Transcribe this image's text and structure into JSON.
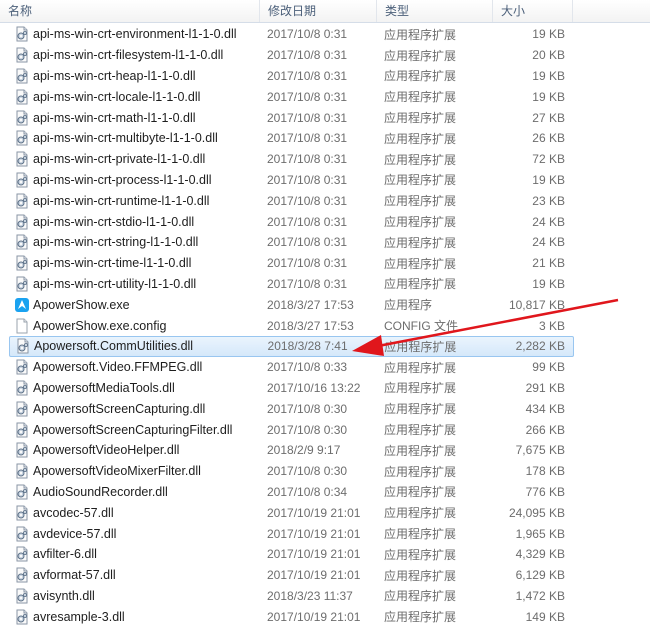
{
  "columns": {
    "name": "名称",
    "date": "修改日期",
    "type": "类型",
    "size": "大小"
  },
  "files": [
    {
      "name": "api-ms-win-crt-environment-l1-1-0.dll",
      "date": "2017/10/8 0:31",
      "type": "应用程序扩展",
      "size": "19 KB",
      "icon": "dll-file-icon"
    },
    {
      "name": "api-ms-win-crt-filesystem-l1-1-0.dll",
      "date": "2017/10/8 0:31",
      "type": "应用程序扩展",
      "size": "20 KB",
      "icon": "dll-file-icon"
    },
    {
      "name": "api-ms-win-crt-heap-l1-1-0.dll",
      "date": "2017/10/8 0:31",
      "type": "应用程序扩展",
      "size": "19 KB",
      "icon": "dll-file-icon"
    },
    {
      "name": "api-ms-win-crt-locale-l1-1-0.dll",
      "date": "2017/10/8 0:31",
      "type": "应用程序扩展",
      "size": "19 KB",
      "icon": "dll-file-icon"
    },
    {
      "name": "api-ms-win-crt-math-l1-1-0.dll",
      "date": "2017/10/8 0:31",
      "type": "应用程序扩展",
      "size": "27 KB",
      "icon": "dll-file-icon"
    },
    {
      "name": "api-ms-win-crt-multibyte-l1-1-0.dll",
      "date": "2017/10/8 0:31",
      "type": "应用程序扩展",
      "size": "26 KB",
      "icon": "dll-file-icon"
    },
    {
      "name": "api-ms-win-crt-private-l1-1-0.dll",
      "date": "2017/10/8 0:31",
      "type": "应用程序扩展",
      "size": "72 KB",
      "icon": "dll-file-icon"
    },
    {
      "name": "api-ms-win-crt-process-l1-1-0.dll",
      "date": "2017/10/8 0:31",
      "type": "应用程序扩展",
      "size": "19 KB",
      "icon": "dll-file-icon"
    },
    {
      "name": "api-ms-win-crt-runtime-l1-1-0.dll",
      "date": "2017/10/8 0:31",
      "type": "应用程序扩展",
      "size": "23 KB",
      "icon": "dll-file-icon"
    },
    {
      "name": "api-ms-win-crt-stdio-l1-1-0.dll",
      "date": "2017/10/8 0:31",
      "type": "应用程序扩展",
      "size": "24 KB",
      "icon": "dll-file-icon"
    },
    {
      "name": "api-ms-win-crt-string-l1-1-0.dll",
      "date": "2017/10/8 0:31",
      "type": "应用程序扩展",
      "size": "24 KB",
      "icon": "dll-file-icon"
    },
    {
      "name": "api-ms-win-crt-time-l1-1-0.dll",
      "date": "2017/10/8 0:31",
      "type": "应用程序扩展",
      "size": "21 KB",
      "icon": "dll-file-icon"
    },
    {
      "name": "api-ms-win-crt-utility-l1-1-0.dll",
      "date": "2017/10/8 0:31",
      "type": "应用程序扩展",
      "size": "19 KB",
      "icon": "dll-file-icon"
    },
    {
      "name": "ApowerShow.exe",
      "date": "2018/3/27 17:53",
      "type": "应用程序",
      "size": "10,817 KB",
      "icon": "apowershow-app-icon"
    },
    {
      "name": "ApowerShow.exe.config",
      "date": "2018/3/27 17:53",
      "type": "CONFIG 文件",
      "size": "3 KB",
      "icon": "config-file-icon"
    },
    {
      "name": "Apowersoft.CommUtilities.dll",
      "date": "2018/3/28 7:41",
      "type": "应用程序扩展",
      "size": "2,282 KB",
      "icon": "dll-file-icon",
      "selected": true
    },
    {
      "name": "Apowersoft.Video.FFMPEG.dll",
      "date": "2017/10/8 0:33",
      "type": "应用程序扩展",
      "size": "99 KB",
      "icon": "dll-file-icon"
    },
    {
      "name": "ApowersoftMediaTools.dll",
      "date": "2017/10/16 13:22",
      "type": "应用程序扩展",
      "size": "291 KB",
      "icon": "dll-file-icon"
    },
    {
      "name": "ApowersoftScreenCapturing.dll",
      "date": "2017/10/8 0:30",
      "type": "应用程序扩展",
      "size": "434 KB",
      "icon": "dll-file-icon"
    },
    {
      "name": "ApowersoftScreenCapturingFilter.dll",
      "date": "2017/10/8 0:30",
      "type": "应用程序扩展",
      "size": "266 KB",
      "icon": "dll-file-icon"
    },
    {
      "name": "ApowersoftVideoHelper.dll",
      "date": "2018/2/9 9:17",
      "type": "应用程序扩展",
      "size": "7,675 KB",
      "icon": "dll-file-icon"
    },
    {
      "name": "ApowersoftVideoMixerFilter.dll",
      "date": "2017/10/8 0:30",
      "type": "应用程序扩展",
      "size": "178 KB",
      "icon": "dll-file-icon"
    },
    {
      "name": "AudioSoundRecorder.dll",
      "date": "2017/10/8 0:34",
      "type": "应用程序扩展",
      "size": "776 KB",
      "icon": "dll-file-icon"
    },
    {
      "name": "avcodec-57.dll",
      "date": "2017/10/19 21:01",
      "type": "应用程序扩展",
      "size": "24,095 KB",
      "icon": "dll-file-icon"
    },
    {
      "name": "avdevice-57.dll",
      "date": "2017/10/19 21:01",
      "type": "应用程序扩展",
      "size": "1,965 KB",
      "icon": "dll-file-icon"
    },
    {
      "name": "avfilter-6.dll",
      "date": "2017/10/19 21:01",
      "type": "应用程序扩展",
      "size": "4,329 KB",
      "icon": "dll-file-icon"
    },
    {
      "name": "avformat-57.dll",
      "date": "2017/10/19 21:01",
      "type": "应用程序扩展",
      "size": "6,129 KB",
      "icon": "dll-file-icon"
    },
    {
      "name": "avisynth.dll",
      "date": "2018/3/23 11:37",
      "type": "应用程序扩展",
      "size": "1,472 KB",
      "icon": "dll-file-icon"
    },
    {
      "name": "avresample-3.dll",
      "date": "2017/10/19 21:01",
      "type": "应用程序扩展",
      "size": "149 KB",
      "icon": "dll-file-icon"
    }
  ],
  "colors": {
    "selection": "#cce4f7",
    "selection_border": "#99c6f0",
    "arrow": "#e0161c",
    "secondary_text": "#6d6d6d"
  }
}
